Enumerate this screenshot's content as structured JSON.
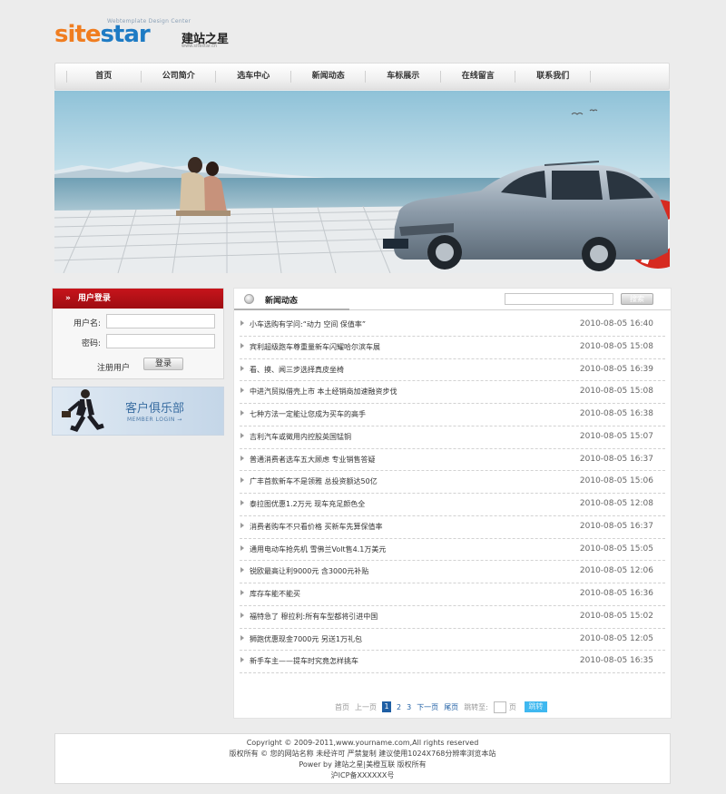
{
  "logo": {
    "tagline": "Webtemplate Design Center",
    "word_a": "site",
    "word_b": "star",
    "name_cn": "建站之星",
    "url": "www.sitestar.cn"
  },
  "nav": {
    "items": [
      "首页",
      "公司简介",
      "选车中心",
      "新闻动态",
      "车标展示",
      "在线留言",
      "联系我们"
    ]
  },
  "login": {
    "title": "用户登录",
    "raquo": "»",
    "username_label": "用户名:",
    "password_label": "密码:",
    "register_label": "注册用户",
    "login_button": "登录"
  },
  "club": {
    "title": "客户俱乐部",
    "subtitle": "MEMBER LOGIN →"
  },
  "news": {
    "title": "新闻动态",
    "search_button": "搜索",
    "items": [
      {
        "title": "小车选购有学问:“动力 空间 保值率”",
        "date": "2010-08-05 16:40"
      },
      {
        "title": "宾利超级跑车尊重量新车闪耀哈尔滨车展",
        "date": "2010-08-05 15:08"
      },
      {
        "title": "看、摸、闻三步选择真皮坐椅",
        "date": "2010-08-05 16:39"
      },
      {
        "title": "中进汽贸拟借壳上市 本土经销商加速融资步伐",
        "date": "2010-08-05 15:08"
      },
      {
        "title": "七种方法一定能让您成为买车的高手",
        "date": "2010-08-05 16:38"
      },
      {
        "title": "吉利汽车或徵用内控股英国锰铜",
        "date": "2010-08-05 15:07"
      },
      {
        "title": "普通消费者选车五大顾虑 专业销售答疑",
        "date": "2010-08-05 16:37"
      },
      {
        "title": "广丰首款新车不是领雅 总投资额达50亿",
        "date": "2010-08-05 15:06"
      },
      {
        "title": "泰拉图优惠1.2万元 现车充足颜色全",
        "date": "2010-08-05 12:08"
      },
      {
        "title": "消费者购车不只看价格 买新车先算保值率",
        "date": "2010-08-05 16:37"
      },
      {
        "title": "通用电动车抢先机 雪佛兰Volt售4.1万美元",
        "date": "2010-08-05 15:05"
      },
      {
        "title": "锐欧最高让利9000元 含3000元补贴",
        "date": "2010-08-05 12:06"
      },
      {
        "title": "库存车能不能买",
        "date": "2010-08-05 16:36"
      },
      {
        "title": "福特急了 穆拉利:所有车型都将引进中国",
        "date": "2010-08-05 15:02"
      },
      {
        "title": "狮跑优惠现金7000元 另送1万礼包",
        "date": "2010-08-05 12:05"
      },
      {
        "title": "新手车主——提车时究竟怎样挑车",
        "date": "2010-08-05 16:35"
      }
    ]
  },
  "pager": {
    "first": "首页",
    "prev": "上一页",
    "pages": [
      "1",
      "2",
      "3"
    ],
    "current": "1",
    "next": "下一页",
    "last": "尾页",
    "jump_label": "跳转至:",
    "page_unit": "页",
    "go": "跳转"
  },
  "footer": {
    "line1": "Copyright © 2009-2011,www.yourname.com,All rights reserved",
    "line2": "版权所有 © 您的网站名称 未经许可 严禁复制 建议使用1024X768分辨率浏览本站",
    "line3": "Power by 建站之星|美橙互联 版权所有",
    "line4": "沪ICP备XXXXXX号"
  },
  "colors": {
    "brand_orange": "#f07d20",
    "brand_blue": "#1e7bc4",
    "login_red": "#b3111a",
    "pager_blue": "#1f5fa4",
    "go_button": "#3fb8f0"
  }
}
